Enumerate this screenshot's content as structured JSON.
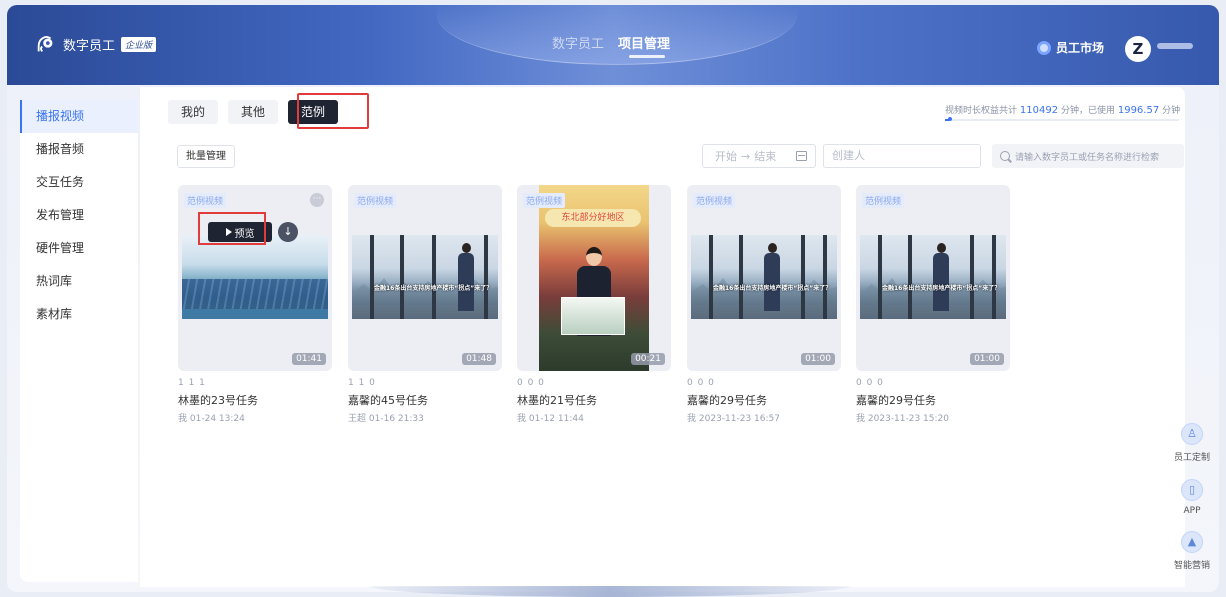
{
  "header": {
    "logo_text": "数字员工",
    "edition": "企业版",
    "nav": [
      "数字员工",
      "项目管理"
    ],
    "market": "员工市场",
    "avatar_letter": "Z"
  },
  "sidebar": {
    "items": [
      "播报视频",
      "播报音频",
      "交互任务",
      "发布管理",
      "硬件管理",
      "热词库",
      "素材库"
    ],
    "active_index": 0
  },
  "tabs": [
    "我的",
    "其他",
    "范例"
  ],
  "active_tab": "范例",
  "quota": {
    "prefix": "视频时长权益共计",
    "total": "110492",
    "mid": "分钟，已使用",
    "used": "1996.57",
    "suffix": "分钟",
    "used_fraction": 0.018
  },
  "toolbar": {
    "batch": "批量管理",
    "start": "开始",
    "arrow": "→",
    "end": "结束",
    "creator_placeholder": "创建人",
    "search_placeholder": "请输入数字员工或任务名称进行检索"
  },
  "cards": [
    {
      "tag": "范例视频",
      "duration": "01:41",
      "meta": "1  1  1",
      "title": "林墨的23号任务",
      "author": "我",
      "time": "01-24 13:24",
      "thumb": "solar"
    },
    {
      "tag": "范例视频",
      "duration": "01:48",
      "meta": "1  1  0",
      "title": "嘉馨的45号任务",
      "author": "王超",
      "time": "01-16 21:33",
      "thumb": "office"
    },
    {
      "tag": "范例视频",
      "duration": "00:21",
      "meta": "0  0  0",
      "title": "林墨的21号任务",
      "author": "我",
      "time": "01-12 11:44",
      "thumb": "vertical"
    },
    {
      "tag": "范例视频",
      "duration": "01:00",
      "meta": "0  0  0",
      "title": "嘉馨的29号任务",
      "author": "我",
      "time": "2023-11-23 16:57",
      "thumb": "office"
    },
    {
      "tag": "范例视频",
      "duration": "01:00",
      "meta": "0  0  0",
      "title": "嘉馨的29号任务",
      "author": "我",
      "time": "2023-11-23 15:20",
      "thumb": "office"
    }
  ],
  "preview_label": "预览",
  "thumb_caption": "金融16条出台支持房地产楼市“拐点”来了？",
  "vertical_banner": "东北部分好地区",
  "float": [
    "员工定制",
    "APP",
    "智能营销"
  ]
}
